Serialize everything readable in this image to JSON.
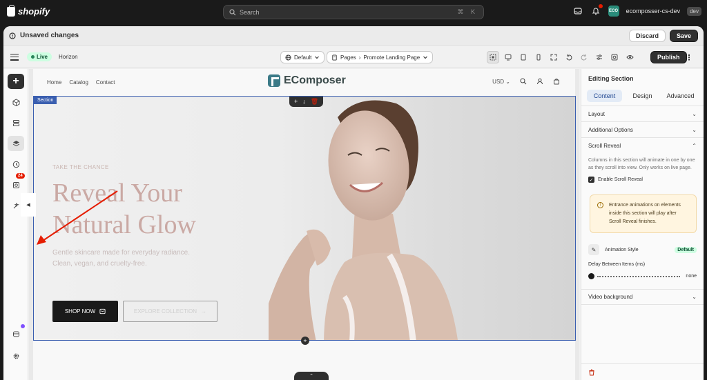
{
  "topbar": {
    "brand": "shopify",
    "search_placeholder": "Search",
    "search_shortcut": "⌘ K",
    "store_badge": "ECO",
    "store_name": "ecomposser-cs-dev",
    "store_tag": "dev"
  },
  "unsaved": {
    "title": "Unsaved changes",
    "discard": "Discard",
    "save": "Save"
  },
  "toolbar": {
    "live": "Live",
    "theme": "Horizon",
    "default_select": "Default",
    "pages_label": "Pages",
    "page_select": "Promote Landing Page",
    "publish": "Publish",
    "more": "⋮"
  },
  "leftbar": {
    "add": "+",
    "badge_count": "24"
  },
  "store": {
    "nav": [
      "Home",
      "Catalog",
      "Contact"
    ],
    "logo": "EComposer",
    "currency": "USD"
  },
  "section": {
    "tag": "Section",
    "tools": [
      "+",
      "↓",
      "🗑"
    ],
    "eyebrow": "TAKE THE CHANCE",
    "headline_1": "Reveal Your",
    "headline_2": "Natural Glow",
    "sub_1": "Gentle skincare made for everyday radiance.",
    "sub_2": "Clean, vegan, and cruelty-free.",
    "cta_primary": "SHOP NOW",
    "cta_secondary": "EXPLORE COLLECTION"
  },
  "rightpanel": {
    "title": "Editing Section",
    "tabs": [
      "Content",
      "Design",
      "Advanced"
    ],
    "layout": "Layout",
    "additional": "Additional Options",
    "scroll_reveal": "Scroll Reveal",
    "scroll_desc": "Columns in this section will animate in one by one as they scroll into view. Only works on live page.",
    "enable_scroll": "Enable Scroll Reveal",
    "warning": "Entrance animations on elements inside this section will play after Scroll Reveal finishes.",
    "animation_style": "Animation Style",
    "default_badge": "Default",
    "delay_label": "Delay Between Items (ms)",
    "delay_value": "none",
    "video_bg": "Video background"
  },
  "colors": {
    "selection": "#3b5fb0",
    "arrow": "#e51c00",
    "live_bg": "#cdfee1"
  }
}
